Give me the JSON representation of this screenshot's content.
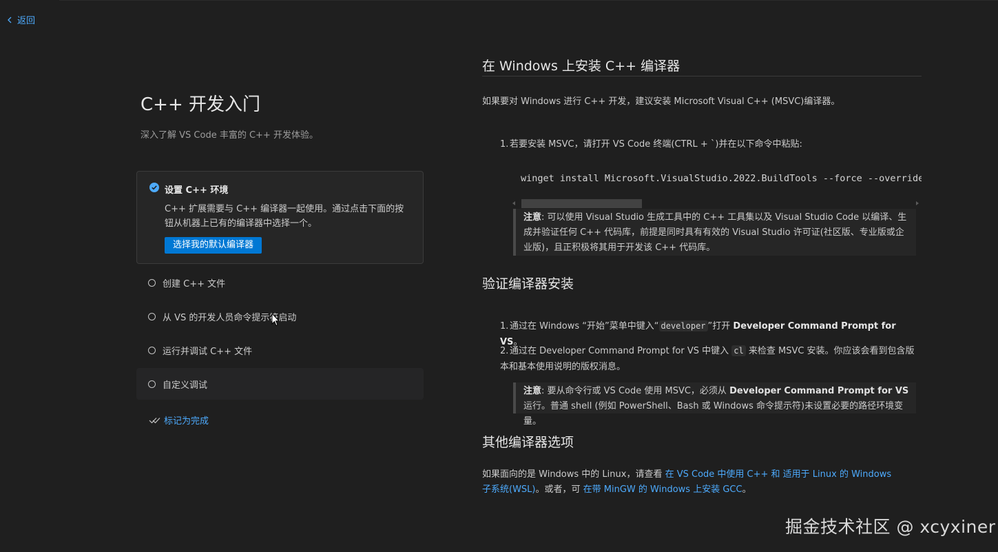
{
  "nav": {
    "back_label": "返回"
  },
  "walkthrough": {
    "title": "C++ 开发入门",
    "subtitle": "深入了解 VS Code 丰富的 C++ 开发体验。",
    "active_step": {
      "title": "设置 C++ 环境",
      "description": "C++ 扩展需要与 C++ 编译器一起使用。通过点击下面的按钮从机器上已有的编译器中选择一个。",
      "button_label": "选择我的默认编译器"
    },
    "steps": [
      {
        "label": "创建 C++ 文件"
      },
      {
        "label": "从 VS 的开发人员命令提示符启动"
      },
      {
        "label": "运行并调试 C++ 文件"
      },
      {
        "label": "自定义调试"
      }
    ],
    "mark_done_label": "标记为完成"
  },
  "content": {
    "h_install": "在 Windows 上安装 C++ 编译器",
    "p_intro": "如果要对 Windows 进行 C++ 开发，建议安装 Microsoft Visual C++ (MSVC)编译器。",
    "step1_num": "1.",
    "step1_text": "若要安装 MSVC，请打开 VS Code 终端(CTRL + `)并在以下命令中粘贴:",
    "code_command": "winget install Microsoft.VisualStudio.2022.BuildTools --force --override \"--wait --passive --add Microsoft.VisualStudio.Workload.VCTools\"",
    "note1_label": "注意",
    "note1_text": ": 可以使用 Visual Studio 生成工具中的 C++ 工具集以及 Visual Studio Code 以编译、生成并验证任何 C++ 代码库，前提是同时具有有效的 Visual Studio 许可证(社区版、专业版或企业版)，且正积极将其用于开发该 C++ 代码库。",
    "h_verify": "验证编译器安装",
    "v1_num": "1.",
    "v1_pre": "通过在 Windows “开始”菜单中键入“",
    "v1_code": "developer",
    "v1_mid": "”打开 ",
    "v1_bold": "Developer Command Prompt for VS",
    "v1_post": "。",
    "v2_num": "2.",
    "v2_pre": "通过在 Developer Command Prompt for VS 中键入 ",
    "v2_code": "cl",
    "v2_post": " 来检查 MSVC 安装。你应该会看到包含版本和基本使用说明的版权消息。",
    "note2_label": "注意",
    "note2_pre": ": 要从命令行或 VS Code 使用 MSVC，必须从 ",
    "note2_bold": "Developer Command Prompt for VS",
    "note2_post": " 运行。普通 shell (例如 PowerShell、Bash 或 Windows 命令提示符)未设置必要的路径环境变量。",
    "h_other": "其他编译器选项",
    "o_pre": "如果面向的是 Windows 中的 Linux，请查看 ",
    "o_link1": "在 VS Code 中使用 C++ 和 适用于 Linux 的 Windows 子系统(WSL)",
    "o_mid": "。或者，可 ",
    "o_link2": "在带 MinGW 的 Windows 上安装 GCC",
    "o_post": "。"
  },
  "watermark": "掘金技术社区 @ xcyxiner",
  "colors": {
    "accent": "#0078d4",
    "link": "#4daafc",
    "background": "#1f1f1f"
  }
}
